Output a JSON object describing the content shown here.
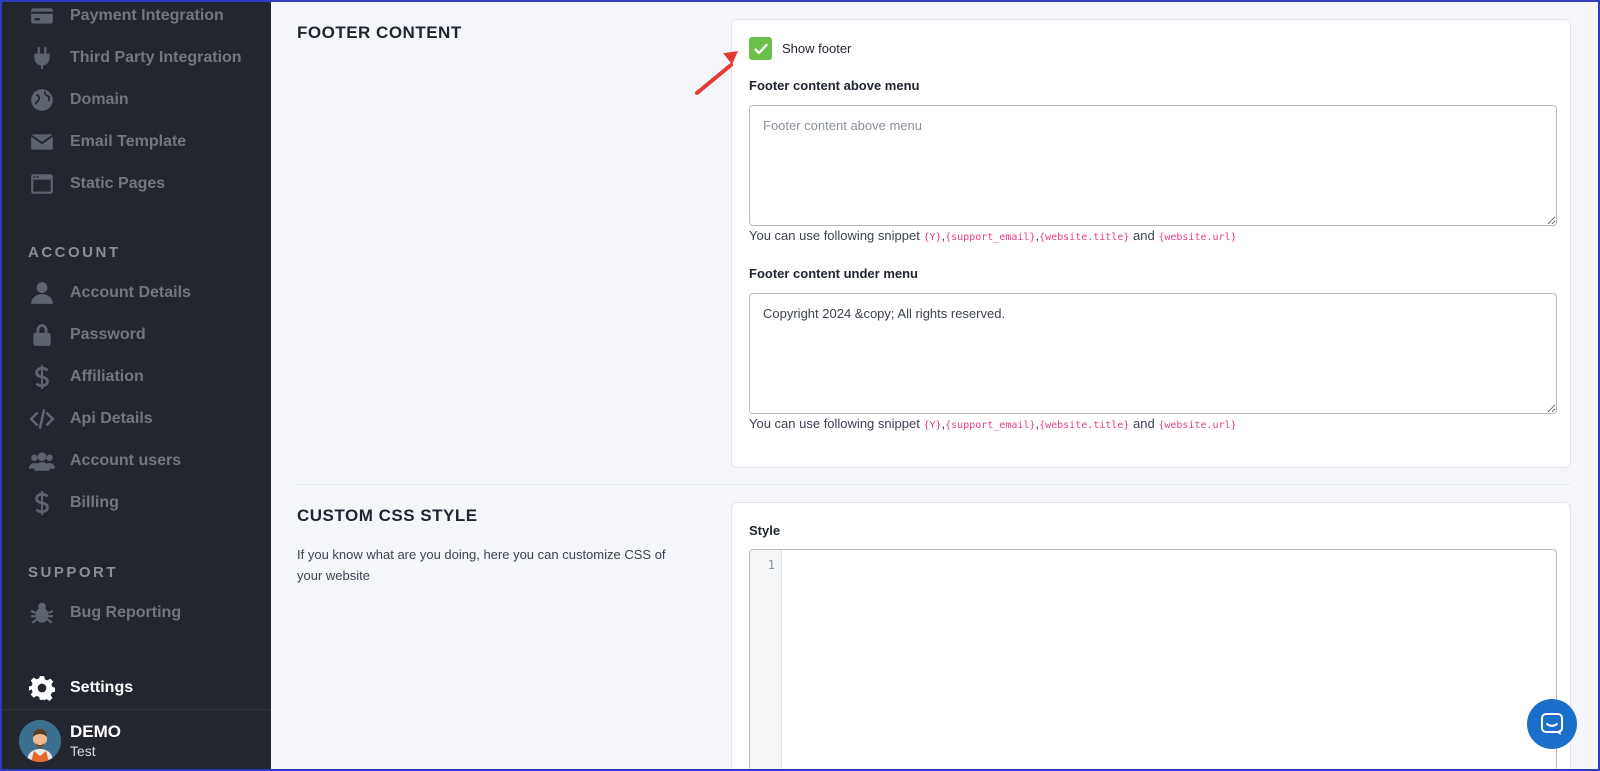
{
  "sidebar": {
    "items_top": [
      {
        "label": "Payment Integration",
        "icon": "payment-icon"
      },
      {
        "label": "Third Party Integration",
        "icon": "plug-icon"
      },
      {
        "label": "Domain",
        "icon": "globe-icon"
      },
      {
        "label": "Email Template",
        "icon": "envelope-icon"
      },
      {
        "label": "Static Pages",
        "icon": "window-icon"
      }
    ],
    "account_title": "ACCOUNT",
    "items_account": [
      {
        "label": "Account Details",
        "icon": "user-icon"
      },
      {
        "label": "Password",
        "icon": "lock-icon"
      },
      {
        "label": "Affiliation",
        "icon": "dollar-icon"
      },
      {
        "label": "Api Details",
        "icon": "code-icon"
      },
      {
        "label": "Account users",
        "icon": "users-icon"
      },
      {
        "label": "Billing",
        "icon": "dollar-icon"
      }
    ],
    "support_title": "SUPPORT",
    "items_support": [
      {
        "label": "Bug Reporting",
        "icon": "bug-icon"
      }
    ],
    "settings_label": "Settings",
    "user": {
      "name": "DEMO",
      "sub": "Test"
    }
  },
  "footer_section": {
    "title": "FOOTER CONTENT",
    "show_footer_label": "Show footer",
    "show_footer_checked": true,
    "above_label": "Footer content above menu",
    "above_placeholder": "Footer content above menu",
    "above_value": "",
    "under_label": "Footer content under menu",
    "under_value": "Copyright 2024 &copy; All rights reserved.",
    "hint_prefix": "You can use following snippet",
    "snippets": [
      "{Y}",
      "{support_email}",
      "{website.title}",
      "{website.url}"
    ],
    "hint_and": "and"
  },
  "css_section": {
    "title": "CUSTOM CSS STYLE",
    "description": "If you know what are you doing, here you can customize CSS of your website",
    "style_label": "Style",
    "line_number": "1"
  },
  "colors": {
    "sidebar_bg": "#23252f",
    "checkbox_green": "#6cc04a",
    "snippet_pink": "#e83e8c",
    "chat_blue": "#1a6fc9",
    "arrow_red": "#e53935"
  }
}
